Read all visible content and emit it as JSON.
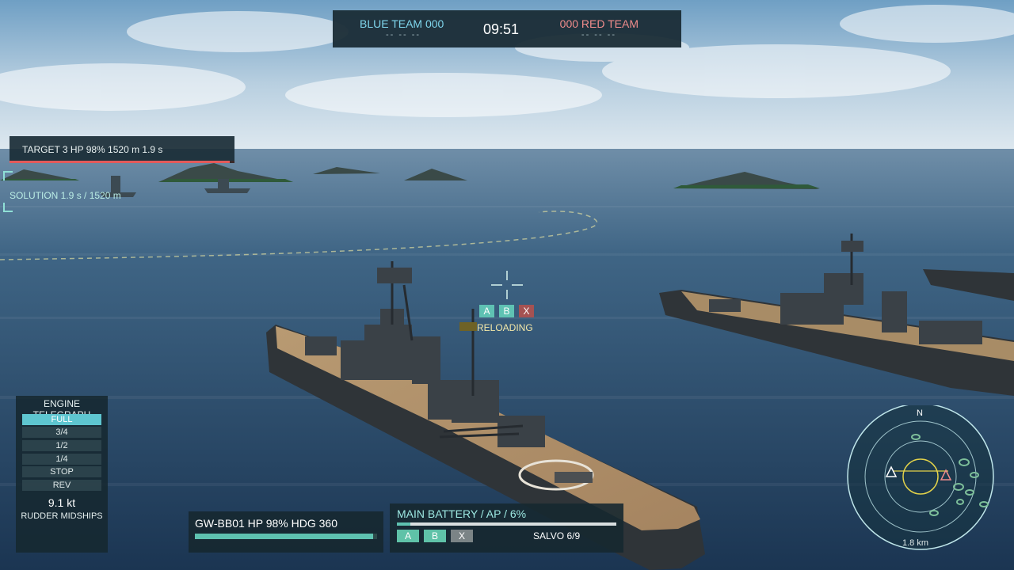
{
  "scoreboard": {
    "blue_team": "BLUE TEAM 000",
    "blue_sub": "-- -- --",
    "timer": "09:51",
    "red_team": "000 RED TEAM",
    "red_sub": "-- -- --"
  },
  "target": {
    "info": "TARGET 3   HP  98%   1520 m   1.9 s",
    "hp_fraction": 0.98,
    "solution": "SOLUTION  1.9 s / 1520 m"
  },
  "aim": {
    "ammo": [
      "A",
      "B",
      "X"
    ],
    "reload_label": "RELOADING"
  },
  "telegraph": {
    "title": "ENGINE TELEGRAPH",
    "items": [
      "FULL",
      "3/4",
      "1/2",
      "1/4",
      "STOP",
      "REV"
    ],
    "active_item": "FULL",
    "speed": "9.1 kt",
    "rudder": "RUDDER  MIDSHIPS"
  },
  "ship": {
    "status": "GW-BB01   HP  98%   HDG 360",
    "hp_fraction": 0.98
  },
  "weapon": {
    "title": "MAIN BATTERY  /  AP  /    6%",
    "reload_fraction": 0.06,
    "slots": [
      "A",
      "B",
      "X"
    ],
    "salvo": "SALVO 6/9"
  },
  "minimap": {
    "north": "N",
    "range": "1.8 km"
  },
  "colors": {
    "blue_team": "#7fd6ec",
    "red_team": "#f08c8c",
    "accent": "#5ec6d0",
    "enemy": "#e35a5a"
  },
  "icons": [
    "crosshair-icon",
    "minimap-compass",
    "player-ship-marker-icon",
    "enemy-ship-marker-icon",
    "target-bracket-icon"
  ]
}
